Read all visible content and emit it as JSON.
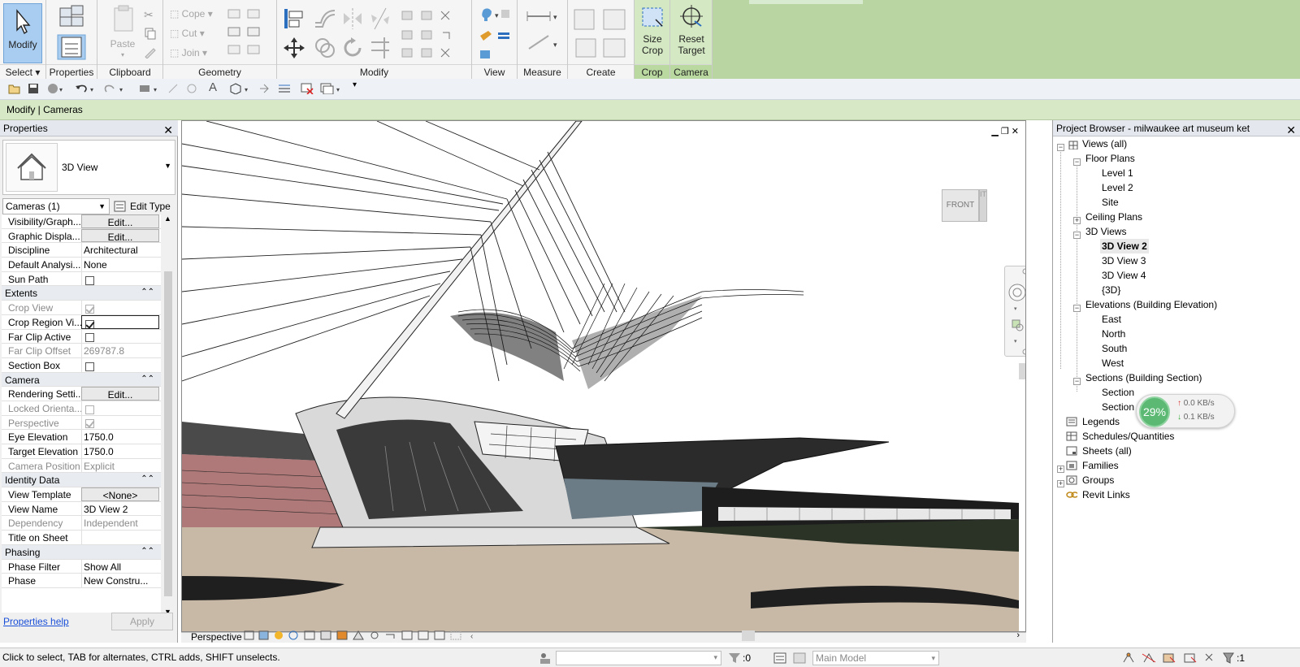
{
  "ribbon": {
    "panels": {
      "select": "Select",
      "properties": "Properties",
      "clipboard": "Clipboard",
      "geometry": "Geometry",
      "modify": "Modify",
      "view": "View",
      "measure": "Measure",
      "create": "Create",
      "crop": "Crop",
      "camera": "Camera"
    },
    "buttons": {
      "modify": "Modify",
      "paste": "Paste",
      "cope": "Cope",
      "cut": "Cut",
      "join": "Join",
      "size_crop_1": "Size",
      "size_crop_2": "Crop",
      "reset_target_1": "Reset",
      "reset_target_2": "Target"
    }
  },
  "context_bar": "Modify | Cameras",
  "properties": {
    "title": "Properties",
    "type_name": "3D View",
    "instance_filter": "Cameras (1)",
    "edit_type": "Edit Type",
    "rows": [
      {
        "k": "Visibility/Graph...",
        "v": "Edit..."
      },
      {
        "k": "Graphic Displa...",
        "v": "Edit..."
      },
      {
        "k": "Discipline",
        "v": "Architectural"
      },
      {
        "k": "Default Analysi...",
        "v": "None"
      },
      {
        "k": "Sun Path",
        "v": ""
      },
      {
        "k": "Extents",
        "v": ""
      },
      {
        "k": "Crop View",
        "v": ""
      },
      {
        "k": "Crop Region Vi...",
        "v": ""
      },
      {
        "k": "Far Clip Active",
        "v": ""
      },
      {
        "k": "Far Clip Offset",
        "v": "269787.8"
      },
      {
        "k": "Section Box",
        "v": ""
      },
      {
        "k": "Camera",
        "v": ""
      },
      {
        "k": "Rendering Setti...",
        "v": "Edit..."
      },
      {
        "k": "Locked Orienta...",
        "v": ""
      },
      {
        "k": "Perspective",
        "v": ""
      },
      {
        "k": "Eye Elevation",
        "v": "1750.0"
      },
      {
        "k": "Target Elevation",
        "v": "1750.0"
      },
      {
        "k": "Camera Position",
        "v": "Explicit"
      },
      {
        "k": "Identity Data",
        "v": ""
      },
      {
        "k": "View Template",
        "v": "<None>"
      },
      {
        "k": "View Name",
        "v": "3D View 2"
      },
      {
        "k": "Dependency",
        "v": "Independent"
      },
      {
        "k": "Title on Sheet",
        "v": ""
      },
      {
        "k": "Phasing",
        "v": ""
      },
      {
        "k": "Phase Filter",
        "v": "Show All"
      },
      {
        "k": "Phase",
        "v": "New Constru..."
      }
    ],
    "help": "Properties help",
    "apply": "Apply"
  },
  "view": {
    "viewcube_face": "FRONT",
    "viewcube_side": "IT",
    "control_bar_label": "Perspective"
  },
  "browser": {
    "title": "Project Browser - milwaukee art museum ket",
    "nodes": {
      "views_all": "Views (all)",
      "floor_plans": "Floor Plans",
      "level1": "Level 1",
      "level2": "Level 2",
      "site": "Site",
      "ceiling_plans": "Ceiling Plans",
      "views_3d": "3D Views",
      "v3d2": "3D View 2",
      "v3d3": "3D View 3",
      "v3d4": "3D View 4",
      "v3d": "{3D}",
      "elevations": "Elevations (Building Elevation)",
      "east": "East",
      "north": "North",
      "south": "South",
      "west": "West",
      "sections": "Sections (Building Section)",
      "section1": "Section",
      "section2": "Section",
      "legends": "Legends",
      "schedules": "Schedules/Quantities",
      "sheets": "Sheets (all)",
      "families": "Families",
      "groups": "Groups",
      "revit_links": "Revit Links"
    }
  },
  "net_badge": {
    "percent": "29%",
    "up": "0.0 KB/s",
    "down": "0.1 KB/s"
  },
  "status": {
    "message": "Click to select, TAB for alternates, CTRL adds, SHIFT unselects.",
    "count": ":0",
    "model": "Main Model",
    "filter_count": ":1"
  }
}
